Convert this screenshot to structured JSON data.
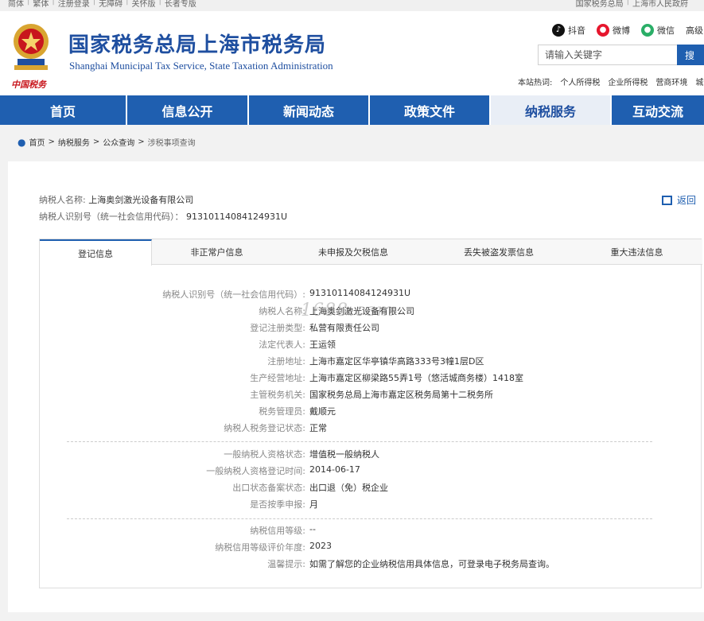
{
  "topbar": {
    "left": [
      "简体",
      "繁体",
      "注册登录",
      "无障碍",
      "关怀版",
      "长者专版"
    ],
    "right": [
      "国家税务总局",
      "上海市人民政府"
    ]
  },
  "header": {
    "brand_small": "中国税务",
    "title_cn": "国家税务总局上海市税务局",
    "title_en": "Shanghai Municipal Tax Service, State Taxation Administration",
    "social": [
      {
        "icon": "douyin-icon",
        "label": "抖音"
      },
      {
        "icon": "weibo-icon",
        "label": "微博"
      },
      {
        "icon": "wechat-icon",
        "label": "微信"
      },
      {
        "icon": "",
        "label": "高级"
      }
    ],
    "search_placeholder": "请输入关键字",
    "search_btn": "搜",
    "hot_label": "本站热词:",
    "hot_words": [
      "个人所得税",
      "企业所得税",
      "营商环境",
      "城"
    ]
  },
  "nav": {
    "items": [
      "首页",
      "信息公开",
      "新闻动态",
      "政策文件",
      "纳税服务",
      "互动交流"
    ],
    "active_index": 4
  },
  "breadcrumb": {
    "items": [
      "首页",
      "纳税服务",
      "公众查询"
    ],
    "current": "涉税事项查询"
  },
  "taxpayer": {
    "name_label": "纳税人名称:",
    "name": "上海奥剑激光设备有限公司",
    "id_label": "纳税人识别号（统一社会信用代码）：",
    "id": "91310114084124931U",
    "back_label": "返回"
  },
  "tabs": [
    "登记信息",
    "非正常户信息",
    "未申报及欠税信息",
    "丢失被盗发票信息",
    "重大违法信息"
  ],
  "active_tab": 0,
  "registration_rows": [
    {
      "k": "纳税人识别号（统一社会信用代码）:",
      "v": "91310114084124931U"
    },
    {
      "k": "纳税人名称:",
      "v": "上海奥剑激光设备有限公司"
    },
    {
      "k": "登记注册类型:",
      "v": "私营有限责任公司"
    },
    {
      "k": "法定代表人:",
      "v": "王运领"
    },
    {
      "k": "注册地址:",
      "v": "上海市嘉定区华亭镇华高路333号3幢1层D区"
    },
    {
      "k": "生产经营地址:",
      "v": "上海市嘉定区柳梁路55弄1号（悠活城商务楼）1418室"
    },
    {
      "k": "主管税务机关:",
      "v": "国家税务总局上海市嘉定区税务局第十二税务所"
    },
    {
      "k": "税务管理员:",
      "v": "戴顺元"
    },
    {
      "k": "纳税人税务登记状态:",
      "v": "正常"
    }
  ],
  "vat_rows": [
    {
      "k": "一般纳税人资格状态:",
      "v": "增值税一般纳税人"
    },
    {
      "k": "一般纳税人资格登记时间:",
      "v": "2014-06-17"
    },
    {
      "k": "出口状态备案状态:",
      "v": "出口退（免）税企业"
    },
    {
      "k": "是否按季申报:",
      "v": "月"
    }
  ],
  "credit_rows": [
    {
      "k": "纳税信用等级:",
      "v": "--"
    },
    {
      "k": "纳税信用等级评价年度:",
      "v": "2023"
    },
    {
      "k": "温馨提示:",
      "v": "如需了解您的企业纳税信用具体信息，可登录电子税务局查询。"
    }
  ],
  "watermark": "1688.com"
}
